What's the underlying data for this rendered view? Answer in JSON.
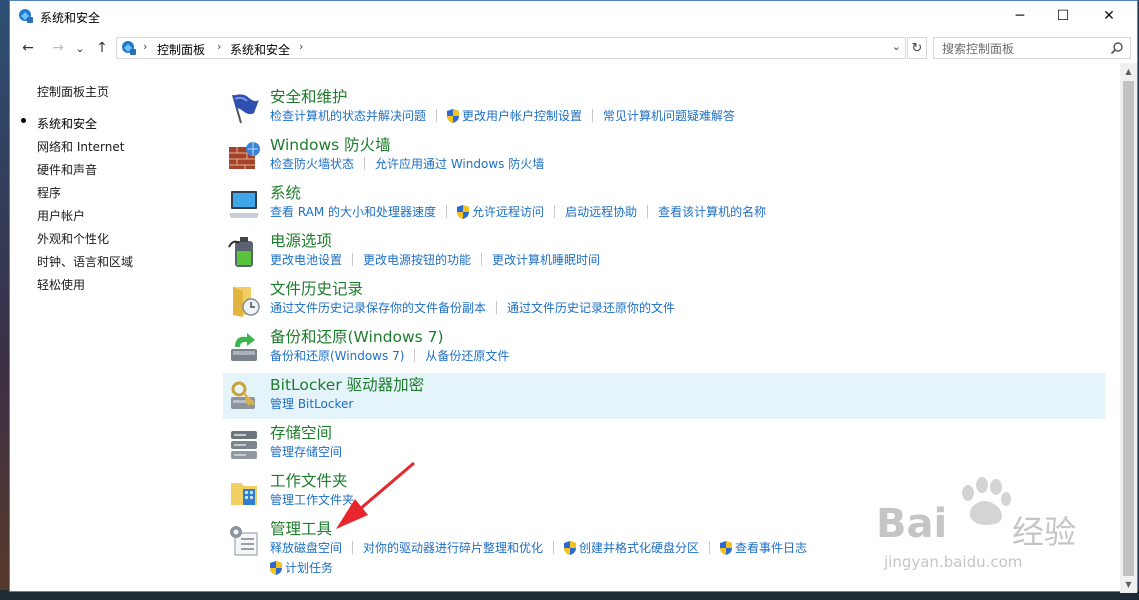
{
  "window": {
    "title": "系统和安全",
    "controls": {
      "minimize": "─",
      "maximize": "☐",
      "close": "✕"
    }
  },
  "nav": {
    "back": "←",
    "forward": "→",
    "dropdown": "⌄",
    "up": "↑",
    "breadcrumb": [
      "控制面板",
      "系统和安全"
    ],
    "separator": "›",
    "refresh": "↻",
    "search_placeholder": "搜索控制面板"
  },
  "sidebar": {
    "items": [
      {
        "label": "控制面板主页"
      },
      {
        "label": "系统和安全",
        "active": true
      },
      {
        "label": "网络和 Internet"
      },
      {
        "label": "硬件和声音"
      },
      {
        "label": "程序"
      },
      {
        "label": "用户帐户"
      },
      {
        "label": "外观和个性化"
      },
      {
        "label": "时钟、语言和区域"
      },
      {
        "label": "轻松使用"
      }
    ]
  },
  "categories": [
    {
      "title": "安全和维护",
      "icon": "flag-icon",
      "links": [
        {
          "text": "检查计算机的状态并解决问题"
        },
        {
          "text": "更改用户帐户控制设置",
          "shield": true
        },
        {
          "text": "常见计算机问题疑难解答"
        }
      ]
    },
    {
      "title": "Windows 防火墙",
      "icon": "firewall-icon",
      "links": [
        {
          "text": "检查防火墙状态"
        },
        {
          "text": "允许应用通过 Windows 防火墙"
        }
      ]
    },
    {
      "title": "系统",
      "icon": "computer-icon",
      "links": [
        {
          "text": "查看 RAM 的大小和处理器速度"
        },
        {
          "text": "允许远程访问",
          "shield": true
        },
        {
          "text": "启动远程协助"
        },
        {
          "text": "查看该计算机的名称"
        }
      ]
    },
    {
      "title": "电源选项",
      "icon": "power-icon",
      "links": [
        {
          "text": "更改电池设置"
        },
        {
          "text": "更改电源按钮的功能"
        },
        {
          "text": "更改计算机睡眠时间"
        }
      ]
    },
    {
      "title": "文件历史记录",
      "icon": "file-history-icon",
      "links": [
        {
          "text": "通过文件历史记录保存你的文件备份副本"
        },
        {
          "text": "通过文件历史记录还原你的文件"
        }
      ]
    },
    {
      "title": "备份和还原(Windows 7)",
      "icon": "backup-icon",
      "links": [
        {
          "text": "备份和还原(Windows 7)"
        },
        {
          "text": "从备份还原文件"
        }
      ]
    },
    {
      "title": "BitLocker 驱动器加密",
      "icon": "bitlocker-icon",
      "highlighted": true,
      "links": [
        {
          "text": "管理 BitLocker"
        }
      ]
    },
    {
      "title": "存储空间",
      "icon": "storage-icon",
      "links": [
        {
          "text": "管理存储空间"
        }
      ]
    },
    {
      "title": "工作文件夹",
      "icon": "work-folders-icon",
      "links": [
        {
          "text": "管理工作文件夹"
        }
      ]
    },
    {
      "title": "管理工具",
      "icon": "admin-tools-icon",
      "links": [
        {
          "text": "释放磁盘空间"
        },
        {
          "text": "对你的驱动器进行碎片整理和优化"
        },
        {
          "text": "创建并格式化硬盘分区",
          "shield": true
        },
        {
          "text": "查看事件日志",
          "shield": true
        }
      ],
      "links2": [
        {
          "text": "计划任务",
          "shield": true
        }
      ]
    }
  ],
  "watermark": {
    "brand": "Bai",
    "brand2": "经验",
    "url": "jingyan.baidu.com"
  },
  "colors": {
    "heading": "#1e7d2c",
    "link": "#1e6fc6",
    "highlight": "#e5f3fb",
    "arrow": "#e8262d"
  }
}
